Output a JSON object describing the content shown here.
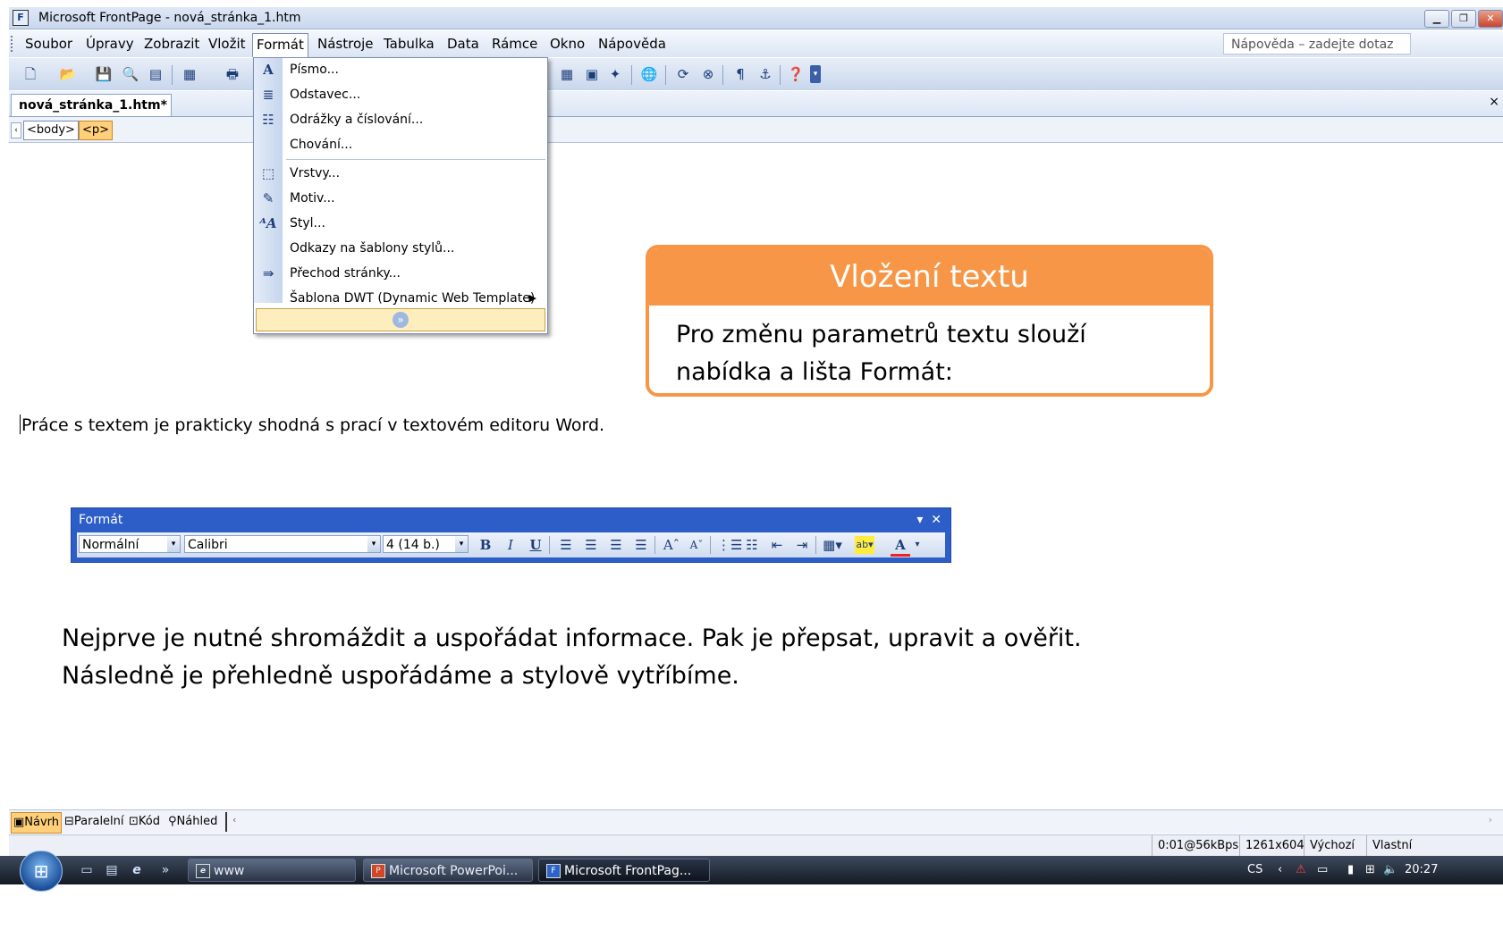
{
  "window": {
    "title": "Microsoft FrontPage - nová_stránka_1.htm",
    "controls": [
      "minimize-icon",
      "restore-icon",
      "close-icon"
    ]
  },
  "menubar": {
    "items": [
      "Soubor",
      "Úpravy",
      "Zobrazit",
      "Vložit",
      "Formát",
      "Nástroje",
      "Tabulka",
      "Data",
      "Rámce",
      "Okno",
      "Nápověda"
    ],
    "active": "Formát",
    "help_placeholder": "Nápověda – zadejte dotaz"
  },
  "document": {
    "tab": "nová_stránka_1.htm*",
    "tags": [
      "<body>",
      "<p>"
    ]
  },
  "format_menu": {
    "items": [
      {
        "label": "Písmo...",
        "icon": "font-icon"
      },
      {
        "label": "Odstavec...",
        "icon": "paragraph-icon"
      },
      {
        "label": "Odrážky a číslování...",
        "icon": "bullets-icon"
      },
      {
        "label": "Chování...",
        "icon": ""
      },
      {
        "label": "Vrstvy...",
        "icon": "layers-icon"
      },
      {
        "label": "Motiv...",
        "icon": "theme-icon"
      },
      {
        "label": "Styl...",
        "icon": "style-icon"
      },
      {
        "label": "Odkazy na šablony stylů...",
        "icon": ""
      },
      {
        "label": "Přechod stránky...",
        "icon": "page-transition-icon"
      },
      {
        "label": "Šablona DWT (Dynamic Web Template)",
        "icon": "",
        "submenu": true
      }
    ],
    "expand_icon": "chevron-double-down-icon"
  },
  "callout": {
    "title": "Vložení textu",
    "body": "Pro změnu parametrů textu slouží nabídka a lišta Formát:",
    "color": "#f79646"
  },
  "content": {
    "line1": "Práce s textem je prakticky shodná s prací v textovém editoru Word.",
    "para1": "Nejprve je nutné shromáždit a uspořádat informace. Pak je přepsat, upravit a ověřit.",
    "para2": "Následně je přehledně uspořádáme a stylově vytříbíme."
  },
  "format_toolbar": {
    "title": "Formát",
    "style": "Normální",
    "font": "Calibri",
    "size": "4 (14 b.)",
    "color": "#2d5ec8"
  },
  "views": [
    "Návrh",
    "Paralelní",
    "Kód",
    "Náhled"
  ],
  "status": [
    "0:01@56kBps",
    "1261x604",
    "Výchozí",
    "Vlastní"
  ],
  "taskbar": {
    "tasks": [
      "www",
      "Microsoft PowerPoi...",
      "Microsoft FrontPag..."
    ],
    "language": "CS",
    "clock": "20:27"
  }
}
